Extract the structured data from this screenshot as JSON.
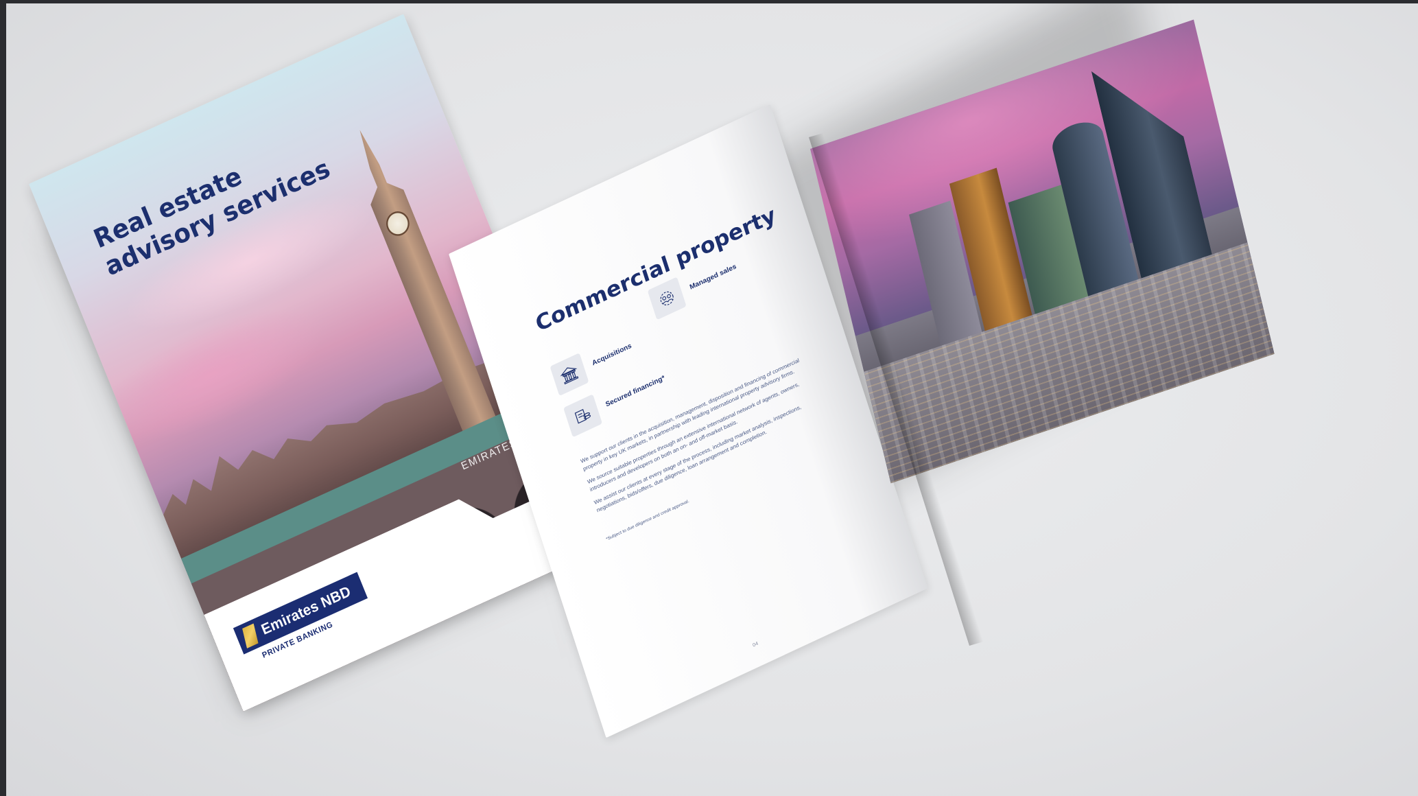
{
  "cover": {
    "title_line1": "Real estate",
    "title_line2": "advisory services",
    "brand_name": "Emirates NBD",
    "brand_sub": "PRIVATE BANKING",
    "partial_text": "EMIRATES NB"
  },
  "inside_page": {
    "title": "Commercial property",
    "features": {
      "acquisitions": "Acquisitions",
      "secured_financing": "Secured financing*",
      "managed_sales": "Managed sales"
    },
    "paragraphs": [
      "We support our clients in the acquisition, management, disposition and financing of commercial property in key UK markets, in partnership with leading international property advisory firms.",
      "We source suitable properties through an extensive international network of agents, owners, introducers and developers on both an on- and off-market basis.",
      "We assist our clients at every stage of the process, including market analysis, inspections, negotiations, bids/offers, due diligence, loan arrangement and completion."
    ],
    "footnote": "*Subject to due diligence and credit approval.",
    "page_number": "04"
  },
  "colors": {
    "brand_navy": "#1c2f6e",
    "brand_gold": "#d6ad3a",
    "background": "#e6e7e9"
  },
  "icons": [
    "bank-building-icon",
    "coins-document-icon",
    "people-gear-icon"
  ]
}
